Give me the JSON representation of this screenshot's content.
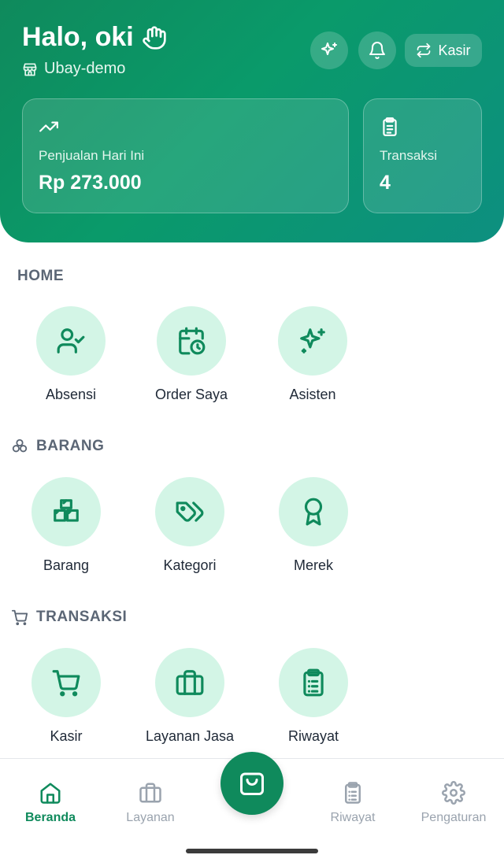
{
  "header": {
    "greeting": "Halo, oki",
    "store_name": "Ubay-demo",
    "kasir_label": "Kasir"
  },
  "cards": {
    "sales": {
      "label": "Penjualan Hari Ini",
      "value": "Rp 273.000"
    },
    "transactions": {
      "label": "Transaksi",
      "value": "4"
    }
  },
  "sections": {
    "home": {
      "title": "HOME",
      "items": [
        {
          "label": "Absensi",
          "icon": "user-check-icon"
        },
        {
          "label": "Order Saya",
          "icon": "calendar-clock-icon"
        },
        {
          "label": "Asisten",
          "icon": "sparkles-icon"
        }
      ]
    },
    "barang": {
      "title": "BARANG",
      "items": [
        {
          "label": "Barang",
          "icon": "boxes-icon"
        },
        {
          "label": "Kategori",
          "icon": "tags-icon"
        },
        {
          "label": "Merek",
          "icon": "award-icon"
        }
      ]
    },
    "transaksi": {
      "title": "TRANSAKSI",
      "items": [
        {
          "label": "Kasir",
          "icon": "cart-icon"
        },
        {
          "label": "Layanan Jasa",
          "icon": "briefcase-icon"
        },
        {
          "label": "Riwayat",
          "icon": "clipboard-list-icon"
        }
      ]
    }
  },
  "bottom_nav": {
    "items": [
      {
        "label": "Beranda",
        "icon": "home-icon",
        "active": true
      },
      {
        "label": "Layanan",
        "icon": "briefcase-icon",
        "active": false
      },
      {
        "label": "Riwayat",
        "icon": "clipboard-list-icon",
        "active": false
      },
      {
        "label": "Pengaturan",
        "icon": "gear-icon",
        "active": false
      }
    ],
    "center_icon": "shopping-bag-icon"
  },
  "colors": {
    "primary": "#0f8a5c",
    "tile_bg": "#d3f5e6",
    "section_title": "#5b6675",
    "nav_inactive": "#9aa3ae"
  }
}
